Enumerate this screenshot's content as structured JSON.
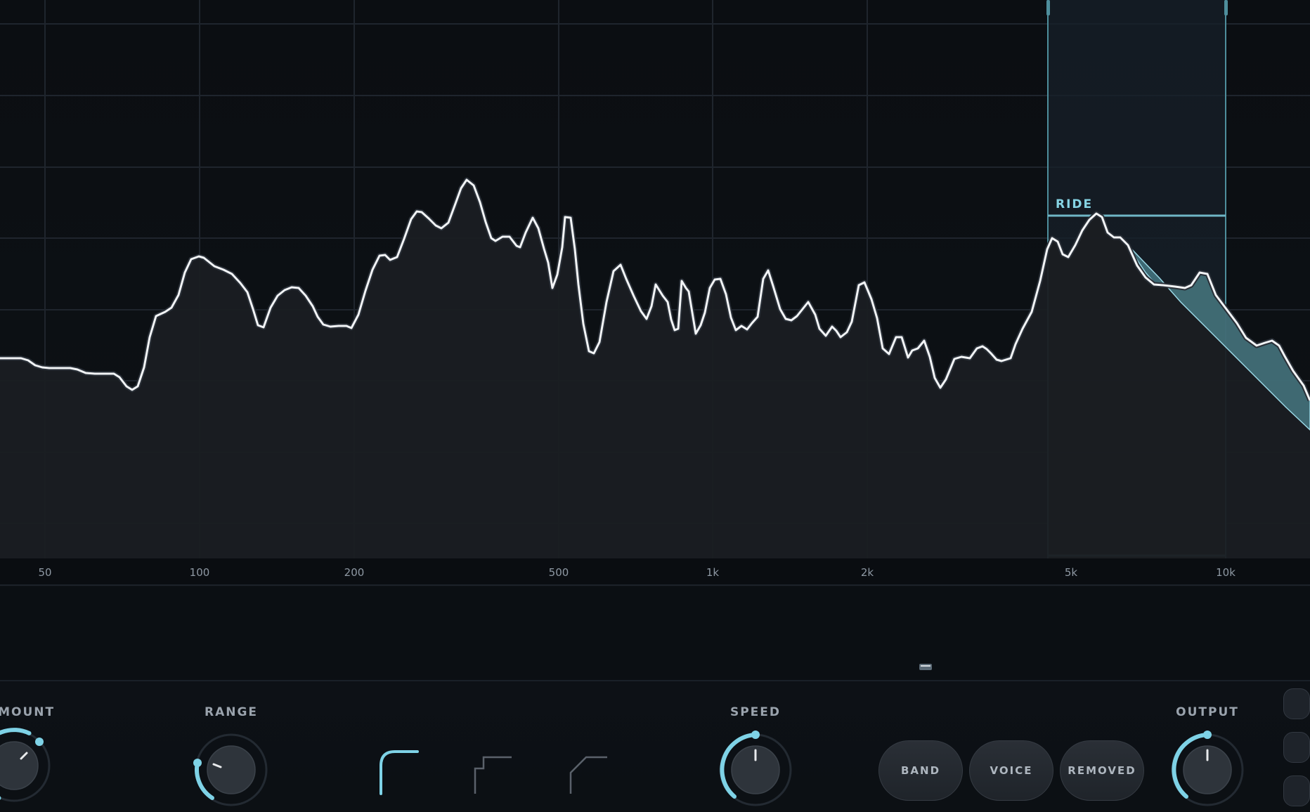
{
  "analyzer": {
    "freq_labels": [
      "50",
      "100",
      "200",
      "500",
      "1k",
      "2k",
      "5k",
      "10k"
    ],
    "band": {
      "label": "RIDE",
      "color": "#86d4e4"
    }
  },
  "controls": {
    "amount": {
      "label": "AMOUNT"
    },
    "range": {
      "label": "RANGE"
    },
    "speed": {
      "label": "SPEED"
    },
    "output": {
      "label": "OUTPUT"
    },
    "modes": [
      "BAND",
      "VOICE",
      "REMOVED"
    ],
    "curve_shapes": [
      "smooth-curve-icon",
      "step-curve-icon",
      "linear-curve-icon"
    ]
  },
  "colors": {
    "accent": "#7ed2e6",
    "background": "#0b0e12",
    "grid": "#20262e",
    "spectrum_line": "#f2f4f6"
  }
}
